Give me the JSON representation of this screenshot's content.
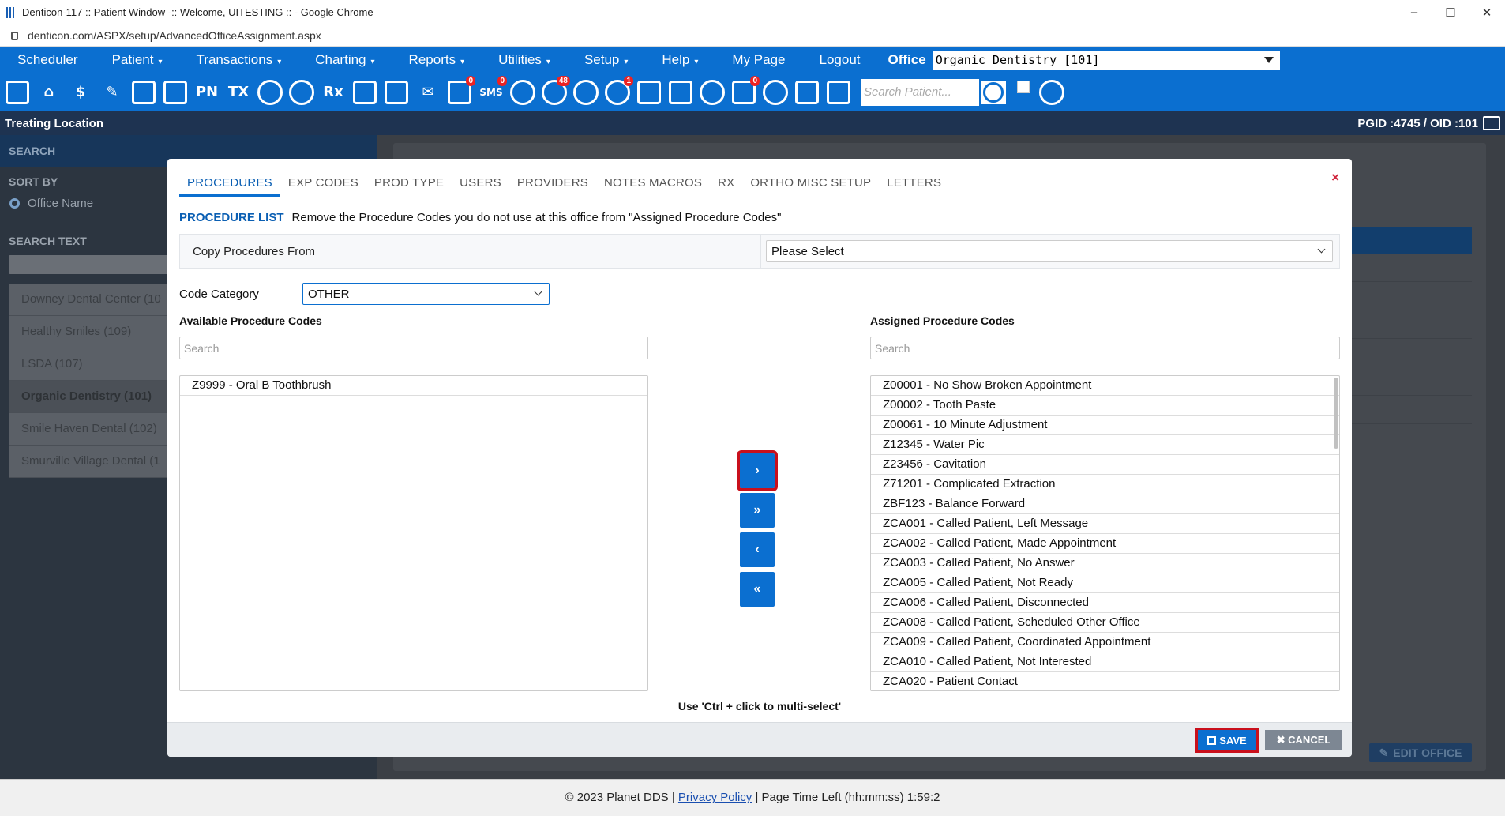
{
  "browser": {
    "title": "Denticon-117 :: Patient Window -:: Welcome, UITESTING :: - Google Chrome",
    "url": "denticon.com/ASPX/setup/AdvancedOfficeAssignment.aspx",
    "controls": {
      "minimize": "–",
      "maximize": "☐",
      "close": "✕"
    }
  },
  "menu": {
    "items": [
      "Scheduler",
      "Patient",
      "Transactions",
      "Charting",
      "Reports",
      "Utilities",
      "Setup",
      "Help",
      "My Page",
      "Logout"
    ],
    "caret": "▾",
    "office_label": "Office",
    "office_value": "Organic Dentistry [101]"
  },
  "toolbar": {
    "badges": {
      "sms": "0",
      "messages": "0",
      "globe": "48",
      "alerts": "1",
      "documents": "0"
    },
    "labels": {
      "pn": "PN",
      "tx": "TX",
      "rx": "Rx",
      "sms": "SMS"
    },
    "search_placeholder": "Search Patient..."
  },
  "location_bar": {
    "title": "Treating Location",
    "ids": "PGID :4745  /  OID :101"
  },
  "left_panel": {
    "search_header": "SEARCH",
    "sort_by": "SORT BY",
    "sort_option": "Office Name",
    "search_text": "SEARCH TEXT",
    "offices": [
      "Downey Dental Center (10",
      "Healthy Smiles (109)",
      "LSDA (107)",
      "Organic Dentistry (101)",
      "Smile Haven Dental (102)",
      "Smurville Village Dental (1"
    ],
    "active_index": 3
  },
  "background": {
    "edit_office": "EDIT OFFICE"
  },
  "modal": {
    "tabs": [
      "PROCEDURES",
      "EXP CODES",
      "PROD TYPE",
      "USERS",
      "PROVIDERS",
      "NOTES MACROS",
      "RX",
      "ORTHO MISC SETUP",
      "LETTERS"
    ],
    "active_tab": 0,
    "close": "×",
    "procedure_list_label": "PROCEDURE LIST",
    "procedure_list_desc": "Remove the Procedure Codes you do not use at this office from \"Assigned Procedure Codes\"",
    "copy_from_label": "Copy Procedures From",
    "copy_from_value": "Please Select",
    "code_category_label": "Code Category",
    "code_category_value": "OTHER",
    "available_title": "Available Procedure Codes",
    "assigned_title": "Assigned Procedure Codes",
    "search_placeholder": "Search",
    "available": [
      "Z9999 - Oral B Toothbrush"
    ],
    "assigned": [
      "Z00001 - No Show Broken Appointment",
      "Z00002 - Tooth Paste",
      "Z00061 - 10 Minute Adjustment",
      "Z12345 - Water Pic",
      "Z23456 - Cavitation",
      "Z71201 - Complicated Extraction",
      "ZBF123 - Balance Forward",
      "ZCA001 - Called Patient, Left Message",
      "ZCA002 - Called Patient, Made Appointment",
      "ZCA003 - Called Patient, No Answer",
      "ZCA005 - Called Patient, Not Ready",
      "ZCA006 - Called Patient, Disconnected",
      "ZCA008 - Called Patient, Scheduled Other Office",
      "ZCA009 - Called Patient, Coordinated Appointment",
      "ZCA010 - Called Patient, Not Interested",
      "ZCA020 - Patient Contact"
    ],
    "move_buttons": {
      "add_one": "›",
      "add_all": "»",
      "remove_one": "‹",
      "remove_all": "«"
    },
    "hint": "Use 'Ctrl + click to multi-select'",
    "save": "SAVE",
    "cancel": "✖  CANCEL"
  },
  "footer": {
    "copyright": "© 2023 Planet DDS",
    "privacy": "Privacy Policy",
    "time_left": "Page Time Left (hh:mm:ss) 1:59:2"
  }
}
